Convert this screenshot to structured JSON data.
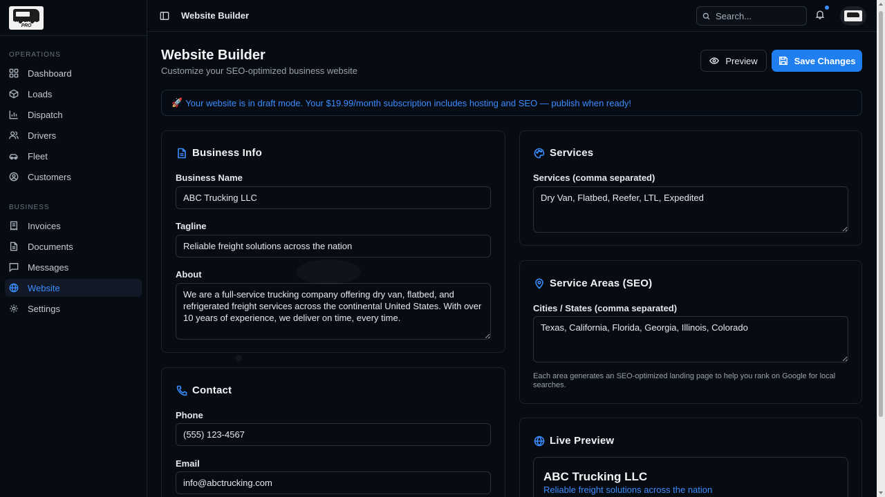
{
  "sidebar": {
    "logo_text": "TRUCKING PRO",
    "sections": [
      {
        "heading": "OPERATIONS",
        "items": [
          {
            "label": "Dashboard",
            "icon": "dashboard-icon",
            "active": false
          },
          {
            "label": "Loads",
            "icon": "package-icon",
            "active": false
          },
          {
            "label": "Dispatch",
            "icon": "bar-chart-icon",
            "active": false
          },
          {
            "label": "Drivers",
            "icon": "users-icon",
            "active": false
          },
          {
            "label": "Fleet",
            "icon": "car-icon",
            "active": false
          },
          {
            "label": "Customers",
            "icon": "user-circle-icon",
            "active": false
          }
        ]
      },
      {
        "heading": "BUSINESS",
        "items": [
          {
            "label": "Invoices",
            "icon": "receipt-icon",
            "active": false
          },
          {
            "label": "Documents",
            "icon": "file-icon",
            "active": false
          },
          {
            "label": "Messages",
            "icon": "message-icon",
            "active": false
          },
          {
            "label": "Website",
            "icon": "globe-icon",
            "active": true
          },
          {
            "label": "Settings",
            "icon": "gear-icon",
            "active": false
          }
        ]
      }
    ]
  },
  "header": {
    "breadcrumb": "Website Builder",
    "search_placeholder": "Search...",
    "has_notification": true
  },
  "page": {
    "title": "Website Builder",
    "subtitle": "Customize your SEO-optimized business website",
    "preview_label": "Preview",
    "save_label": "Save Changes",
    "banner": {
      "emoji": "🚀",
      "text": "Your website is in draft mode. Your $19.99/month subscription includes hosting and SEO — publish when ready!"
    }
  },
  "business_info": {
    "title": "Business Info",
    "name_label": "Business Name",
    "name_value": "ABC Trucking LLC",
    "tagline_label": "Tagline",
    "tagline_value": "Reliable freight solutions across the nation",
    "about_label": "About",
    "about_value": "We are a full-service trucking company offering dry van, flatbed, and refrigerated freight services across the continental United States. With over 10 years of experience, we deliver on time, every time."
  },
  "contact": {
    "title": "Contact",
    "phone_label": "Phone",
    "phone_value": "(555) 123-4567",
    "email_label": "Email",
    "email_value": "info@abctrucking.com"
  },
  "services": {
    "title": "Services",
    "label": "Services (comma separated)",
    "value": "Dry Van, Flatbed, Reefer, LTL, Expedited"
  },
  "service_areas": {
    "title": "Service Areas (SEO)",
    "label": "Cities / States (comma separated)",
    "value": "Texas, California, Florida, Georgia, Illinois, Colorado",
    "helper": "Each area generates an SEO-optimized landing page to help you rank on Google for local searches."
  },
  "live_preview": {
    "title": "Live Preview",
    "business_name": "ABC Trucking LLC",
    "tagline": "Reliable freight solutions across the nation"
  },
  "colors": {
    "accent": "#1f7ef0",
    "accent_text": "#3b8dff",
    "background": "#070b12",
    "border": "#1c222c"
  }
}
